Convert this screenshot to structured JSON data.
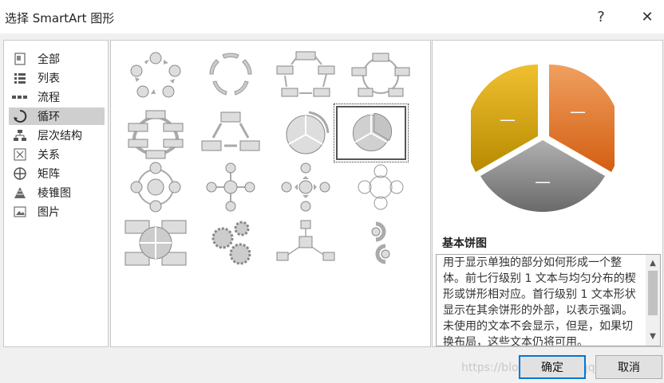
{
  "dialog": {
    "title": "选择 SmartArt 图形",
    "help_label": "?",
    "close_label": "✕"
  },
  "categories": [
    {
      "label": "全部",
      "icon": "all-icon"
    },
    {
      "label": "列表",
      "icon": "list-icon"
    },
    {
      "label": "流程",
      "icon": "process-icon"
    },
    {
      "label": "循环",
      "icon": "cycle-icon",
      "selected": true
    },
    {
      "label": "层次结构",
      "icon": "hierarchy-icon"
    },
    {
      "label": "关系",
      "icon": "relationship-icon"
    },
    {
      "label": "矩阵",
      "icon": "matrix-icon"
    },
    {
      "label": "棱锥图",
      "icon": "pyramid-icon"
    },
    {
      "label": "图片",
      "icon": "picture-icon"
    }
  ],
  "gallery": {
    "selected_index": 7,
    "items": [
      "basic-cycle",
      "text-cycle",
      "block-cycle",
      "nondirectional-cycle",
      "continuous-cycle",
      "multidirectional-cycle",
      "segmented-cycle",
      "basic-pie",
      "radial-cycle",
      "basic-radial",
      "diverging-radial",
      "radial-venn",
      "cycle-matrix",
      "gear",
      "radial-cluster",
      "circle-arrow-process"
    ]
  },
  "preview": {
    "name": "基本饼图",
    "slice_label": "—",
    "colors": {
      "orange": "#e8792a",
      "gold": "#e3ad12",
      "gray": "#9a9a9a"
    },
    "description": "用于显示单独的部分如何形成一个整体。前七行级别 1 文本与均匀分布的楔形或饼形相对应。首行级别 1 文本形状显示在其余饼形的外部，以表示强调。未使用的文本不会显示，但是，如果切换布局，这些文本仍将可用。"
  },
  "buttons": {
    "ok_label": "确定",
    "cancel_label": "取消"
  },
  "watermark": "https://blog.csdn.net/qq_35__05"
}
